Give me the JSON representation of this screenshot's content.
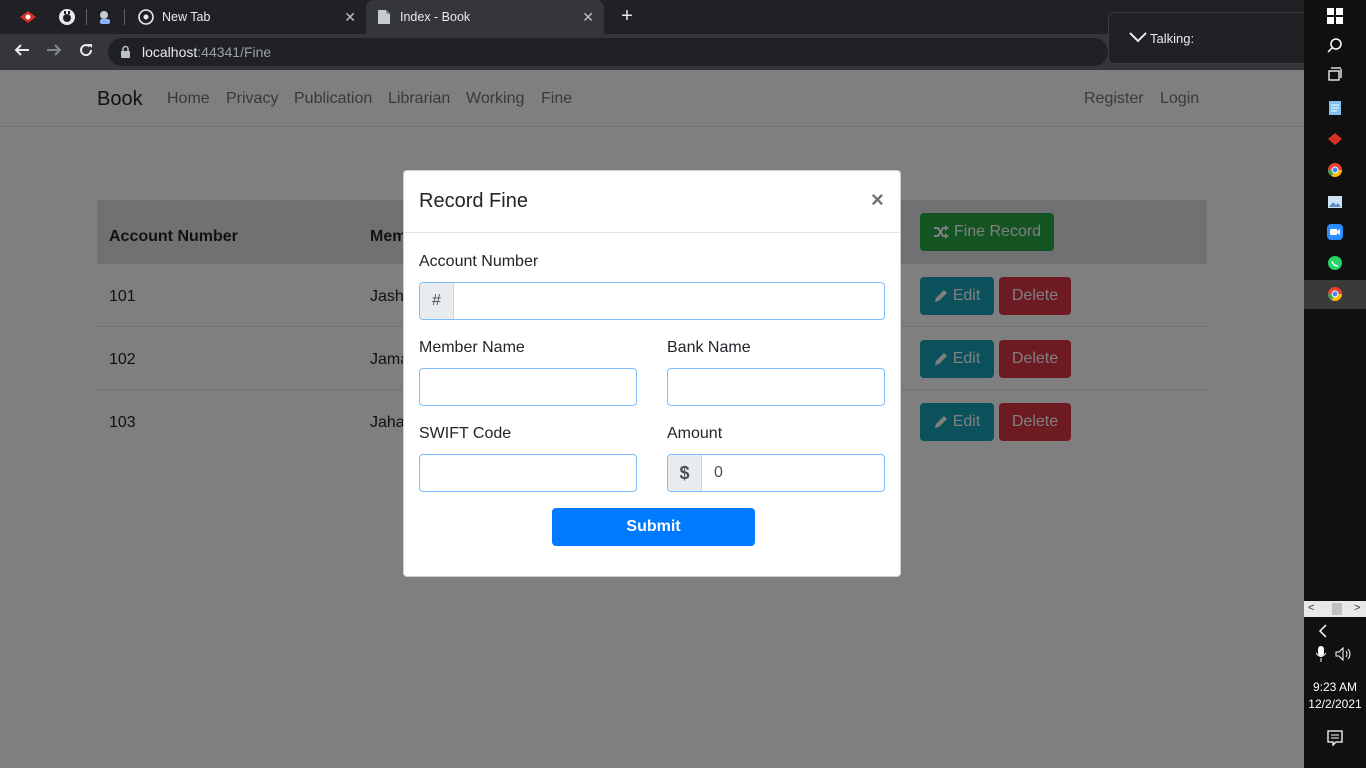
{
  "browser": {
    "tabs": [
      {
        "label": "New Tab",
        "favicon": "chrome-icon"
      },
      {
        "label": "Index - Book",
        "favicon": "document-icon",
        "active": true
      }
    ],
    "url_host": "localhost",
    "url_rest": ":44341/Fine"
  },
  "site": {
    "brand": "Book",
    "nav": [
      "Home",
      "Privacy",
      "Publication",
      "Librarian",
      "Working",
      "Fine"
    ],
    "nav_right": [
      "Register",
      "Login"
    ]
  },
  "table": {
    "headers": [
      "Account Number",
      "Mem"
    ],
    "fine_record_label": "Fine Record",
    "edit_label": "Edit",
    "delete_label": "Delete",
    "rows": [
      {
        "account": "101",
        "member": "Jash"
      },
      {
        "account": "102",
        "member": "Jama"
      },
      {
        "account": "103",
        "member": "Jaha"
      }
    ]
  },
  "modal": {
    "title": "Record Fine",
    "close": "×",
    "account_label": "Account Number",
    "account_addon": "#",
    "account_value": "",
    "member_label": "Member Name",
    "member_value": "",
    "bank_label": "Bank Name",
    "bank_value": "",
    "swift_label": "SWIFT Code",
    "swift_value": "",
    "amount_label": "Amount",
    "amount_addon": "$",
    "amount_value": "0",
    "submit_label": "Submit"
  },
  "overlay": {
    "label": "Talking:"
  },
  "taskbar": {
    "time": "9:23 AM",
    "date": "12/2/2021"
  },
  "colors": {
    "primary": "#007bff",
    "success": "#28a745",
    "info": "#17a2b8",
    "danger": "#dc3545"
  }
}
